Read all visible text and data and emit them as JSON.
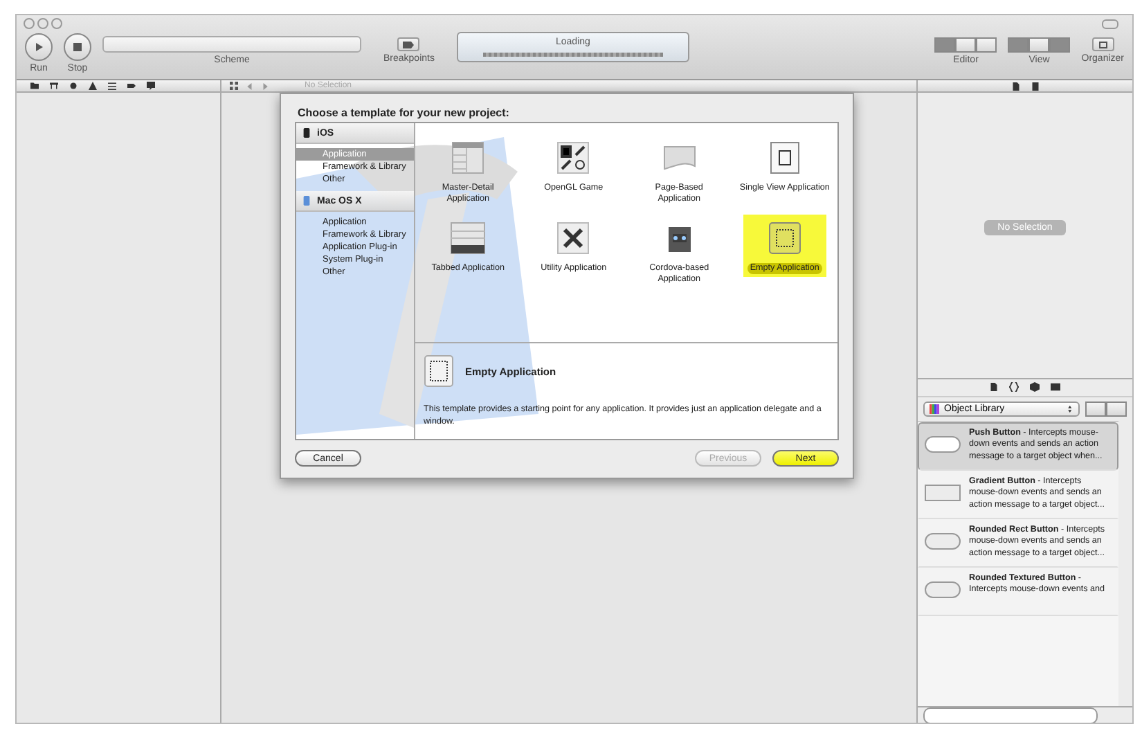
{
  "toolbar": {
    "run": {
      "label": "Run"
    },
    "stop": {
      "label": "Stop"
    },
    "scheme": {
      "label": "Scheme"
    },
    "breakpoints": {
      "label": "Breakpoints"
    },
    "activity": {
      "status": "Loading"
    },
    "editor": {
      "label": "Editor",
      "segments": [
        {
          "selected": true
        },
        {
          "selected": false
        },
        {
          "selected": false
        }
      ]
    },
    "view": {
      "label": "View",
      "segments": [
        {
          "selected": true
        },
        {
          "selected": false
        },
        {
          "selected": true
        }
      ]
    },
    "organizer": {
      "label": "Organizer"
    }
  },
  "editor_jump_bar": {
    "text": "No Selection"
  },
  "sheet": {
    "title": "Choose a template for your new project:",
    "sidebar": [
      {
        "name": "iOS",
        "items": [
          {
            "label": "Application",
            "selected": true
          },
          {
            "label": "Framework & Library",
            "selected": false
          },
          {
            "label": "Other",
            "selected": false
          }
        ]
      },
      {
        "name": "Mac OS X",
        "items": [
          {
            "label": "Application",
            "selected": false
          },
          {
            "label": "Framework & Library",
            "selected": false
          },
          {
            "label": "Application Plug-in",
            "selected": false
          },
          {
            "label": "System Plug-in",
            "selected": false
          },
          {
            "label": "Other",
            "selected": false
          }
        ]
      }
    ],
    "templates": [
      {
        "label": "Master-Detail Application",
        "selected": false
      },
      {
        "label": "OpenGL Game",
        "selected": false
      },
      {
        "label": "Page-Based Application",
        "selected": false
      },
      {
        "label": "Single View Application",
        "selected": false
      },
      {
        "label": "Tabbed Application",
        "selected": false
      },
      {
        "label": "Utility Application",
        "selected": false
      },
      {
        "label": "Cordova-based Application",
        "selected": false
      },
      {
        "label": "Empty Application",
        "selected": true
      }
    ],
    "detail": {
      "title": "Empty Application",
      "description": "This template provides a starting point for any application. It provides just an application delegate and a window."
    },
    "buttons": {
      "cancel": {
        "label": "Cancel"
      },
      "previous": {
        "label": "Previous",
        "disabled": true
      },
      "next": {
        "label": "Next"
      }
    }
  },
  "inspector": {
    "empty_text": "No Selection"
  },
  "library": {
    "popup": "Object Library",
    "items": [
      {
        "name": "Push Button",
        "description": "- Intercepts mouse-down events and sends an action message to a target object when...",
        "selected": true
      },
      {
        "name": "Gradient Button",
        "description": "- Intercepts mouse-down events and sends an action message to a target object...",
        "selected": false
      },
      {
        "name": "Rounded Rect Button",
        "description": "- Intercepts mouse-down events and sends an action message to a target object...",
        "selected": false
      },
      {
        "name": "Rounded Textured Button",
        "description": "- Intercepts mouse-down events and",
        "selected": false
      }
    ]
  }
}
